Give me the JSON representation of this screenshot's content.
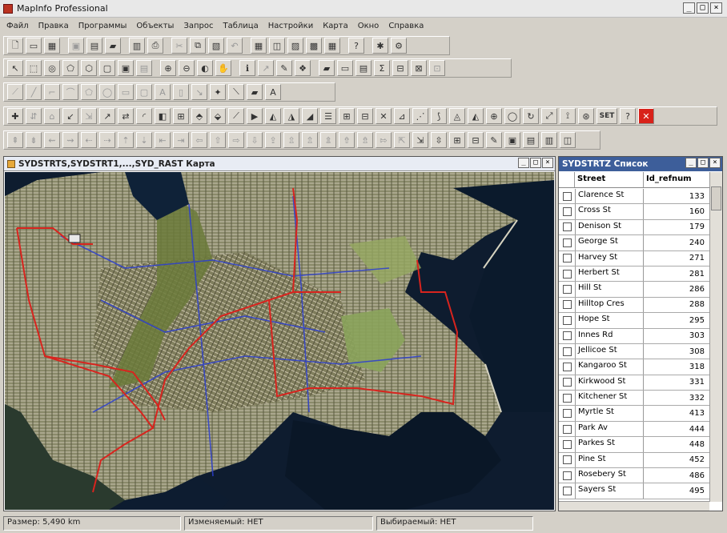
{
  "window": {
    "title": "MapInfo Professional"
  },
  "menu": [
    "Файл",
    "Правка",
    "Программы",
    "Объекты",
    "Запрос",
    "Таблица",
    "Настройки",
    "Карта",
    "Окно",
    "Справка"
  ],
  "toolbar_set": "SET",
  "map_window": {
    "title": "SYDSTRTS,SYDSTRT1,...,SYD_RAST Карта"
  },
  "browser_window": {
    "title": "SYDSTRTZ Список",
    "columns": [
      "Street",
      "Id_refnum"
    ],
    "rows": [
      [
        "Clarence St",
        "133"
      ],
      [
        "Cross St",
        "160"
      ],
      [
        "Denison St",
        "179"
      ],
      [
        "George St",
        "240"
      ],
      [
        "Harvey St",
        "271"
      ],
      [
        "Herbert St",
        "281"
      ],
      [
        "Hill St",
        "286"
      ],
      [
        "Hilltop Cres",
        "288"
      ],
      [
        "Hope St",
        "295"
      ],
      [
        "Innes Rd",
        "303"
      ],
      [
        "Jellicoe St",
        "308"
      ],
      [
        "Kangaroo St",
        "318"
      ],
      [
        "Kirkwood St",
        "331"
      ],
      [
        "Kitchener St",
        "332"
      ],
      [
        "Myrtle St",
        "413"
      ],
      [
        "Park Av",
        "444"
      ],
      [
        "Parkes St",
        "448"
      ],
      [
        "Pine St",
        "452"
      ],
      [
        "Rosebery St",
        "486"
      ],
      [
        "Sayers St",
        "495"
      ]
    ]
  },
  "status": {
    "zoom": "Размер: 5,490 km",
    "editable": "Изменяемый: НЕТ",
    "selectable": "Выбираемый: НЕТ"
  },
  "colors": {
    "map_water": "#0d1b2e",
    "map_land": "#6b6f3a",
    "road_red": "#d8241e",
    "road_blue": "#2b3ed0"
  }
}
